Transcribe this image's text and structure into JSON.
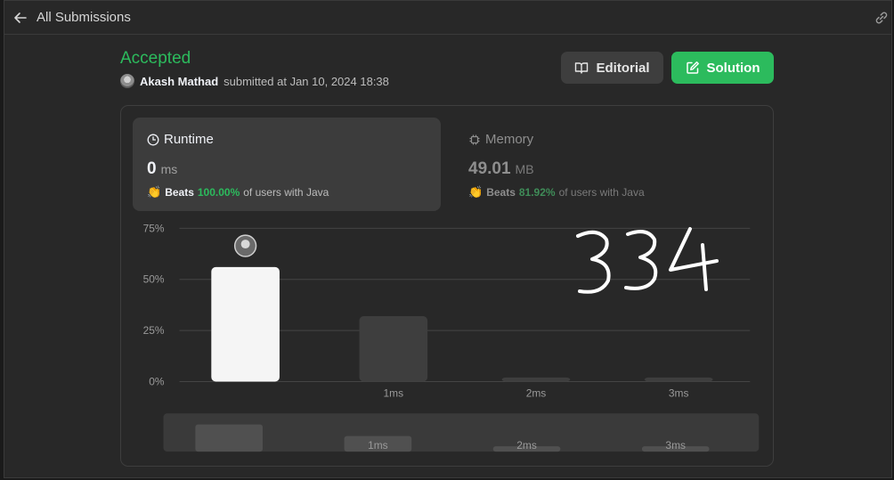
{
  "topbar": {
    "back_label": "All Submissions"
  },
  "submission": {
    "status": "Accepted",
    "user": "Akash Mathad",
    "submitted_text": "submitted at Jan 10, 2024 18:38"
  },
  "buttons": {
    "editorial": "Editorial",
    "solution": "Solution"
  },
  "runtime": {
    "title": "Runtime",
    "value": "0",
    "unit": "ms",
    "beats_label": "Beats",
    "beats_pct": "100.00%",
    "beats_suffix": "of users with Java"
  },
  "memory": {
    "title": "Memory",
    "value": "49.01",
    "unit": "MB",
    "beats_label": "Beats",
    "beats_pct": "81.92%",
    "beats_suffix": "of users with Java"
  },
  "annotation": "334",
  "colors": {
    "accent": "#2cbb5d",
    "background": "#282828",
    "selected_bar": "#f5f5f5",
    "bar": "#3e3e3e"
  },
  "chart_data": {
    "type": "bar",
    "categories": [
      "0ms",
      "1ms",
      "2ms",
      "3ms"
    ],
    "tick_labels": [
      "",
      "1ms",
      "2ms",
      "3ms"
    ],
    "values": [
      56,
      32,
      2,
      2
    ],
    "selected_index": 0,
    "yticks": [
      "0%",
      "25%",
      "50%",
      "75%"
    ],
    "ylim": [
      0,
      75
    ],
    "grid": true,
    "overview": {
      "tick_labels": [
        "",
        "1ms",
        "2ms",
        "3ms"
      ],
      "values": [
        56,
        32,
        2,
        2
      ]
    }
  }
}
